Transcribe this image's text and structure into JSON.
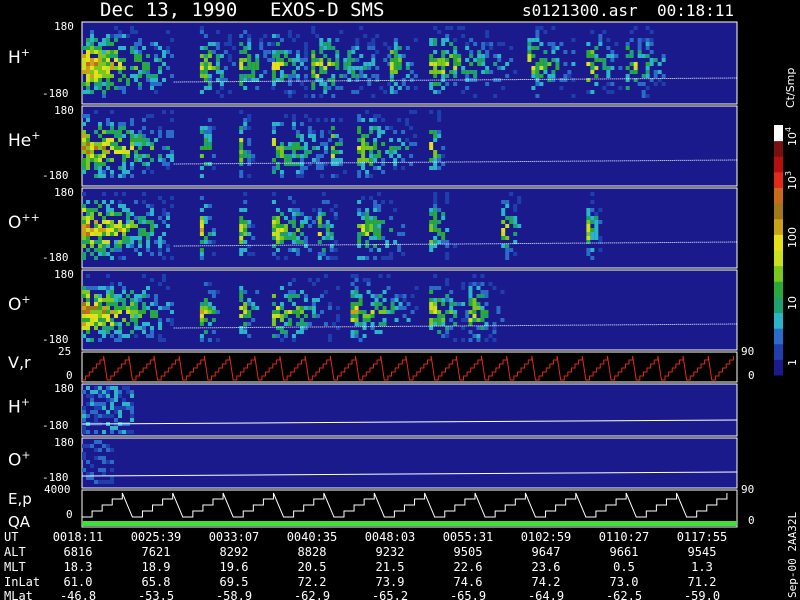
{
  "header": {
    "date": "Dec 13, 1990",
    "instrument": "EXOS-D SMS",
    "file": "s0121300.asr",
    "time": "00:18:11"
  },
  "panels": [
    {
      "id": "hplus",
      "label": "H",
      "sup": "+",
      "ytop": "180",
      "ybot": "-180"
    },
    {
      "id": "heplus",
      "label": "He",
      "sup": "+",
      "ytop": "180",
      "ybot": "-180"
    },
    {
      "id": "oplusplus",
      "label": "O",
      "sup": "++",
      "ytop": "180",
      "ybot": "-180"
    },
    {
      "id": "oplus",
      "label": "O",
      "sup": "+",
      "ytop": "180",
      "ybot": "-180"
    },
    {
      "id": "vr",
      "label": "V,r",
      "ytop": "25",
      "ymid": "0",
      "right_top": "90",
      "right_bot": "0"
    },
    {
      "id": "hplus2",
      "label": "H",
      "sup": "+",
      "ytop": "180",
      "ybot": "-180"
    },
    {
      "id": "oplus2",
      "label": "O",
      "sup": "+",
      "ytop": "180",
      "ybot": "-180"
    },
    {
      "id": "ep",
      "label": "E,p",
      "label2": "QA",
      "ytop": "4000",
      "ymid": "0",
      "right_top": "90",
      "right_bot": "0"
    }
  ],
  "colorbar": {
    "unit": "Ct/Smp",
    "ticks": [
      {
        "base": "10",
        "exp": "4"
      },
      {
        "base": "10",
        "exp": "3"
      },
      {
        "base": "100",
        "exp": ""
      },
      {
        "base": "10",
        "exp": ""
      },
      {
        "base": "1",
        "exp": ""
      }
    ],
    "colors": [
      "#1a1a8c",
      "#1f3fae",
      "#2a6cc8",
      "#2cb5c8",
      "#1fa070",
      "#2aa83a",
      "#7ac81e",
      "#c8e01e",
      "#e6e01a",
      "#c8a31a",
      "#a0781a",
      "#c86a1a",
      "#e02a1a",
      "#b41010",
      "#781010",
      "#ffffff"
    ]
  },
  "side_label": "Sep-00 2AA32L",
  "ephemeris": {
    "row_labels": [
      "UT",
      "ALT",
      "MLT",
      "InLat",
      "MLat"
    ],
    "columns": [
      [
        "0018:11",
        "6816",
        "18.3",
        "61.0",
        "-46.8"
      ],
      [
        "0025:39",
        "7621",
        "18.9",
        "65.8",
        "-53.5"
      ],
      [
        "0033:07",
        "8292",
        "19.6",
        "69.5",
        "-58.9"
      ],
      [
        "0040:35",
        "8828",
        "20.5",
        "72.2",
        "-62.9"
      ],
      [
        "0048:03",
        "9232",
        "21.5",
        "73.9",
        "-65.2"
      ],
      [
        "0055:31",
        "9505",
        "22.6",
        "74.6",
        "-65.9"
      ],
      [
        "0102:59",
        "9647",
        "23.6",
        "74.2",
        "-64.9"
      ],
      [
        "0110:27",
        "9661",
        "0.5",
        "73.0",
        "-62.5"
      ],
      [
        "0117:55",
        "9545",
        "1.3",
        "71.2",
        "-59.0"
      ]
    ]
  },
  "chart_data": {
    "type": "heatmap",
    "x": [
      "0018:11",
      "0025:39",
      "0033:07",
      "0040:35",
      "0048:03",
      "0055:31",
      "0102:59",
      "0110:27",
      "0117:55"
    ],
    "ylim": [
      -180,
      180
    ],
    "series": [
      {
        "name": "H+",
        "bursts": [
          [
            0.0,
            0.14
          ],
          [
            0.18,
            0.05
          ],
          [
            0.24,
            0.05
          ],
          [
            0.29,
            0.05
          ],
          [
            0.35,
            0.12
          ],
          [
            0.47,
            0.04
          ],
          [
            0.53,
            0.13
          ],
          [
            0.68,
            0.07
          ],
          [
            0.77,
            0.05
          ],
          [
            0.83,
            0.06
          ]
        ]
      },
      {
        "name": "He+",
        "bursts": [
          [
            0.0,
            0.14
          ],
          [
            0.18,
            0.02
          ],
          [
            0.24,
            0.02
          ],
          [
            0.29,
            0.09
          ],
          [
            0.38,
            0.02
          ],
          [
            0.42,
            0.09
          ],
          [
            0.53,
            0.02
          ]
        ]
      },
      {
        "name": "O++",
        "bursts": [
          [
            0.0,
            0.14
          ],
          [
            0.18,
            0.02
          ],
          [
            0.24,
            0.02
          ],
          [
            0.29,
            0.08
          ],
          [
            0.36,
            0.03
          ],
          [
            0.42,
            0.07
          ],
          [
            0.53,
            0.04
          ],
          [
            0.64,
            0.03
          ],
          [
            0.77,
            0.02
          ]
        ]
      },
      {
        "name": "O+",
        "bursts": [
          [
            0.0,
            0.14
          ],
          [
            0.18,
            0.03
          ],
          [
            0.24,
            0.03
          ],
          [
            0.29,
            0.1
          ],
          [
            0.41,
            0.1
          ],
          [
            0.53,
            0.06
          ],
          [
            0.59,
            0.05
          ]
        ]
      }
    ],
    "ylim_vr": [
      0,
      25
    ],
    "ylim_ep": [
      0,
      4000
    ]
  }
}
